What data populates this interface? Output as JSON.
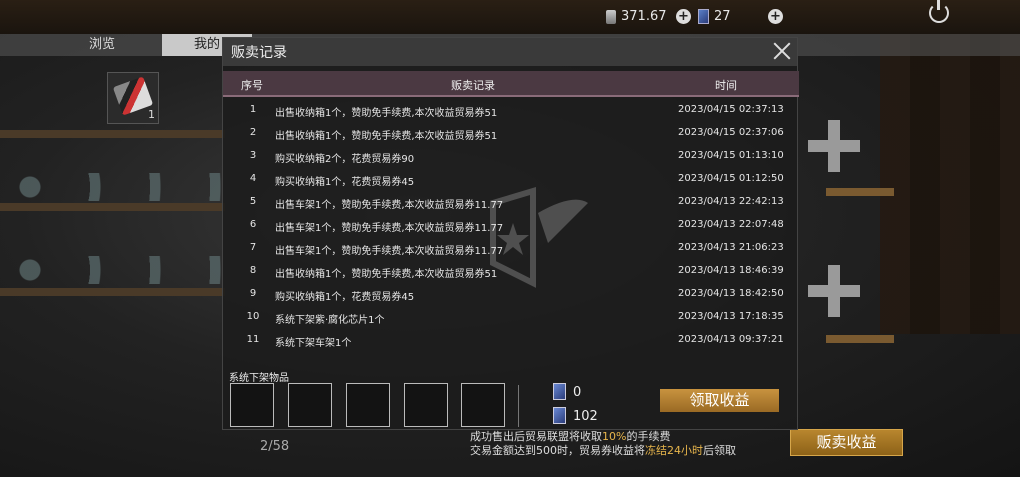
{
  "topbar": {
    "coins": "371.67",
    "tickets": "27"
  },
  "tabs": [
    {
      "label": "浏览"
    },
    {
      "label": "我的"
    }
  ],
  "inventory": {
    "count": "1"
  },
  "page": {
    "indicator": "2/58"
  },
  "hint": {
    "line1_pre": "成功售出后贸易联盟将收取",
    "line1_pct": "10%",
    "line1_post": "的手续费",
    "line2_pre": "交易金额达到500时，贸易券收益将",
    "line2_hl": "冻结24小时",
    "line2_post": "后领取"
  },
  "sell_button": "贩卖收益",
  "modal": {
    "title": "贩卖记录",
    "columns": {
      "no": "序号",
      "record": "贩卖记录",
      "time": "时间"
    },
    "rows": [
      {
        "no": "1",
        "record": "出售收纳箱1个，赞助免手续费,本次收益贸易券51",
        "time": "2023/04/15 02:37:13"
      },
      {
        "no": "2",
        "record": "出售收纳箱1个，赞助免手续费,本次收益贸易券51",
        "time": "2023/04/15 02:37:06"
      },
      {
        "no": "3",
        "record": "购买收纳箱2个，花费贸易券90",
        "time": "2023/04/15 01:13:10"
      },
      {
        "no": "4",
        "record": "购买收纳箱1个，花费贸易券45",
        "time": "2023/04/15 01:12:50"
      },
      {
        "no": "5",
        "record": "出售车架1个，赞助免手续费,本次收益贸易券11.77",
        "time": "2023/04/13 22:42:13"
      },
      {
        "no": "6",
        "record": "出售车架1个，赞助免手续费,本次收益贸易券11.77",
        "time": "2023/04/13 22:07:48"
      },
      {
        "no": "7",
        "record": "出售车架1个，赞助免手续费,本次收益贸易券11.77",
        "time": "2023/04/13 21:06:23"
      },
      {
        "no": "8",
        "record": "出售收纳箱1个，赞助免手续费,本次收益贸易券51",
        "time": "2023/04/13 18:46:39"
      },
      {
        "no": "9",
        "record": "购买收纳箱1个，花费贸易券45",
        "time": "2023/04/13 18:42:50"
      },
      {
        "no": "10",
        "record": "系统下架紫·腐化芯片1个",
        "time": "2023/04/13 17:18:35"
      },
      {
        "no": "11",
        "record": "系统下架车架1个",
        "time": "2023/04/13 09:37:21"
      }
    ],
    "footer": {
      "label": "系统下架物品",
      "ticket_a": "0",
      "ticket_b": "102",
      "claim_label": "领取收益"
    }
  }
}
